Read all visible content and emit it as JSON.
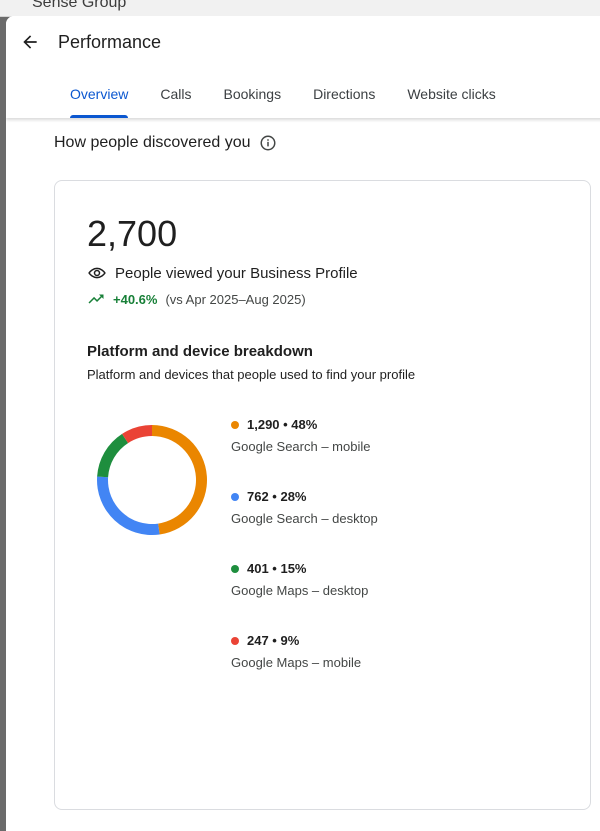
{
  "background": {
    "title": "Sense Group"
  },
  "header": {
    "title": "Performance",
    "tabs": [
      {
        "label": "Overview",
        "active": true
      },
      {
        "label": "Calls"
      },
      {
        "label": "Bookings"
      },
      {
        "label": "Directions"
      },
      {
        "label": "Website clicks"
      }
    ]
  },
  "section": {
    "title": "How people discovered you"
  },
  "stats": {
    "total": "2,700",
    "total_label": "People viewed your Business Profile",
    "trend": "+40.6%",
    "trend_comparison": "(vs Apr 2025–Aug 2025)"
  },
  "breakdown": {
    "title": "Platform and device breakdown",
    "subtitle": "Platform and devices that people used to find your profile",
    "items": [
      {
        "value_text": "1,290 • 48%",
        "label": "Google Search – mobile",
        "value": 1290,
        "percent": 48,
        "color": "#ea8600"
      },
      {
        "value_text": "762 • 28%",
        "label": "Google Search – desktop",
        "value": 762,
        "percent": 28,
        "color": "#4285f4"
      },
      {
        "value_text": "401 • 15%",
        "label": "Google Maps – desktop",
        "value": 401,
        "percent": 15,
        "color": "#1e8e3e"
      },
      {
        "value_text": "247 • 9%",
        "label": "Google Maps – mobile",
        "value": 247,
        "percent": 9,
        "color": "#ea4335"
      }
    ]
  },
  "icons": [
    "arrow-back-icon",
    "info-icon",
    "eye-icon",
    "trending-up-icon"
  ],
  "colors": {
    "accent": "#0b57d0",
    "positive": "#188038"
  }
}
